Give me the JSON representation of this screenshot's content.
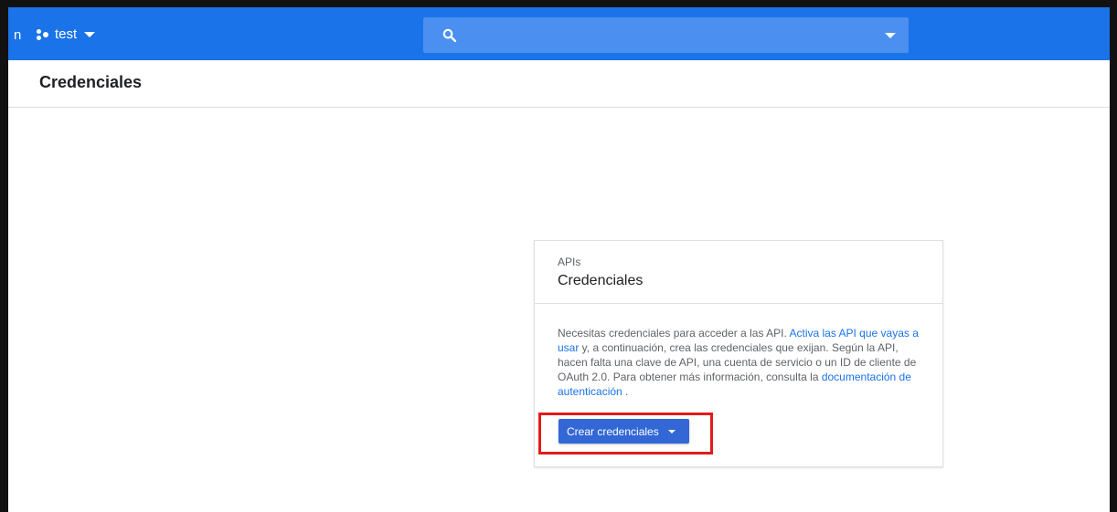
{
  "topbar": {
    "menu_fragment": "n",
    "project_name": "test",
    "search": {
      "value": "",
      "placeholder": ""
    }
  },
  "page": {
    "title": "Credenciales"
  },
  "card": {
    "eyebrow": "APIs",
    "title": "Credenciales",
    "body_1": "Necesitas credenciales para acceder a las API. ",
    "link_enable_apis": "Activa las API que vayas a usar",
    "body_2": " y, a continuación, crea las credenciales que exijan. Según la API, hacen falta una clave de API, una cuenta de servicio o un ID de cliente de OAuth 2.0. Para obtener más información, consulta la ",
    "link_auth_docs": "documentación de autenticación",
    "body_3": " .",
    "button_label": "Crear credenciales"
  },
  "colors": {
    "topbar": "#1a73e8",
    "search_bg": "#4b8ff0",
    "button": "#3367d6",
    "link": "#1a73e8",
    "highlight": "#e21b1b"
  },
  "icons": {
    "project": "project-dots-icon",
    "search": "search-icon",
    "dropdown": "chevron-down-icon"
  }
}
